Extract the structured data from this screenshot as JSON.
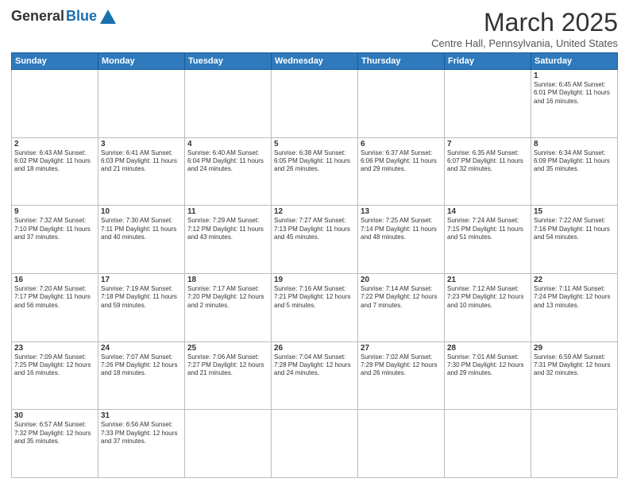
{
  "header": {
    "logo_general": "General",
    "logo_blue": "Blue",
    "month_title": "March 2025",
    "location": "Centre Hall, Pennsylvania, United States"
  },
  "weekdays": [
    "Sunday",
    "Monday",
    "Tuesday",
    "Wednesday",
    "Thursday",
    "Friday",
    "Saturday"
  ],
  "weeks": [
    [
      {
        "day": "",
        "info": ""
      },
      {
        "day": "",
        "info": ""
      },
      {
        "day": "",
        "info": ""
      },
      {
        "day": "",
        "info": ""
      },
      {
        "day": "",
        "info": ""
      },
      {
        "day": "",
        "info": ""
      },
      {
        "day": "1",
        "info": "Sunrise: 6:45 AM\nSunset: 6:01 PM\nDaylight: 11 hours and 16 minutes."
      }
    ],
    [
      {
        "day": "2",
        "info": "Sunrise: 6:43 AM\nSunset: 6:02 PM\nDaylight: 11 hours and 18 minutes."
      },
      {
        "day": "3",
        "info": "Sunrise: 6:41 AM\nSunset: 6:03 PM\nDaylight: 11 hours and 21 minutes."
      },
      {
        "day": "4",
        "info": "Sunrise: 6:40 AM\nSunset: 6:04 PM\nDaylight: 11 hours and 24 minutes."
      },
      {
        "day": "5",
        "info": "Sunrise: 6:38 AM\nSunset: 6:05 PM\nDaylight: 11 hours and 26 minutes."
      },
      {
        "day": "6",
        "info": "Sunrise: 6:37 AM\nSunset: 6:06 PM\nDaylight: 11 hours and 29 minutes."
      },
      {
        "day": "7",
        "info": "Sunrise: 6:35 AM\nSunset: 6:07 PM\nDaylight: 11 hours and 32 minutes."
      },
      {
        "day": "8",
        "info": "Sunrise: 6:34 AM\nSunset: 6:09 PM\nDaylight: 11 hours and 35 minutes."
      }
    ],
    [
      {
        "day": "9",
        "info": "Sunrise: 7:32 AM\nSunset: 7:10 PM\nDaylight: 11 hours and 37 minutes."
      },
      {
        "day": "10",
        "info": "Sunrise: 7:30 AM\nSunset: 7:11 PM\nDaylight: 11 hours and 40 minutes."
      },
      {
        "day": "11",
        "info": "Sunrise: 7:29 AM\nSunset: 7:12 PM\nDaylight: 11 hours and 43 minutes."
      },
      {
        "day": "12",
        "info": "Sunrise: 7:27 AM\nSunset: 7:13 PM\nDaylight: 11 hours and 45 minutes."
      },
      {
        "day": "13",
        "info": "Sunrise: 7:25 AM\nSunset: 7:14 PM\nDaylight: 11 hours and 48 minutes."
      },
      {
        "day": "14",
        "info": "Sunrise: 7:24 AM\nSunset: 7:15 PM\nDaylight: 11 hours and 51 minutes."
      },
      {
        "day": "15",
        "info": "Sunrise: 7:22 AM\nSunset: 7:16 PM\nDaylight: 11 hours and 54 minutes."
      }
    ],
    [
      {
        "day": "16",
        "info": "Sunrise: 7:20 AM\nSunset: 7:17 PM\nDaylight: 11 hours and 56 minutes."
      },
      {
        "day": "17",
        "info": "Sunrise: 7:19 AM\nSunset: 7:18 PM\nDaylight: 11 hours and 59 minutes."
      },
      {
        "day": "18",
        "info": "Sunrise: 7:17 AM\nSunset: 7:20 PM\nDaylight: 12 hours and 2 minutes."
      },
      {
        "day": "19",
        "info": "Sunrise: 7:16 AM\nSunset: 7:21 PM\nDaylight: 12 hours and 5 minutes."
      },
      {
        "day": "20",
        "info": "Sunrise: 7:14 AM\nSunset: 7:22 PM\nDaylight: 12 hours and 7 minutes."
      },
      {
        "day": "21",
        "info": "Sunrise: 7:12 AM\nSunset: 7:23 PM\nDaylight: 12 hours and 10 minutes."
      },
      {
        "day": "22",
        "info": "Sunrise: 7:11 AM\nSunset: 7:24 PM\nDaylight: 12 hours and 13 minutes."
      }
    ],
    [
      {
        "day": "23",
        "info": "Sunrise: 7:09 AM\nSunset: 7:25 PM\nDaylight: 12 hours and 16 minutes."
      },
      {
        "day": "24",
        "info": "Sunrise: 7:07 AM\nSunset: 7:26 PM\nDaylight: 12 hours and 18 minutes."
      },
      {
        "day": "25",
        "info": "Sunrise: 7:06 AM\nSunset: 7:27 PM\nDaylight: 12 hours and 21 minutes."
      },
      {
        "day": "26",
        "info": "Sunrise: 7:04 AM\nSunset: 7:28 PM\nDaylight: 12 hours and 24 minutes."
      },
      {
        "day": "27",
        "info": "Sunrise: 7:02 AM\nSunset: 7:29 PM\nDaylight: 12 hours and 26 minutes."
      },
      {
        "day": "28",
        "info": "Sunrise: 7:01 AM\nSunset: 7:30 PM\nDaylight: 12 hours and 29 minutes."
      },
      {
        "day": "29",
        "info": "Sunrise: 6:59 AM\nSunset: 7:31 PM\nDaylight: 12 hours and 32 minutes."
      }
    ],
    [
      {
        "day": "30",
        "info": "Sunrise: 6:57 AM\nSunset: 7:32 PM\nDaylight: 12 hours and 35 minutes."
      },
      {
        "day": "31",
        "info": "Sunrise: 6:56 AM\nSunset: 7:33 PM\nDaylight: 12 hours and 37 minutes."
      },
      {
        "day": "",
        "info": ""
      },
      {
        "day": "",
        "info": ""
      },
      {
        "day": "",
        "info": ""
      },
      {
        "day": "",
        "info": ""
      },
      {
        "day": "",
        "info": ""
      }
    ]
  ]
}
